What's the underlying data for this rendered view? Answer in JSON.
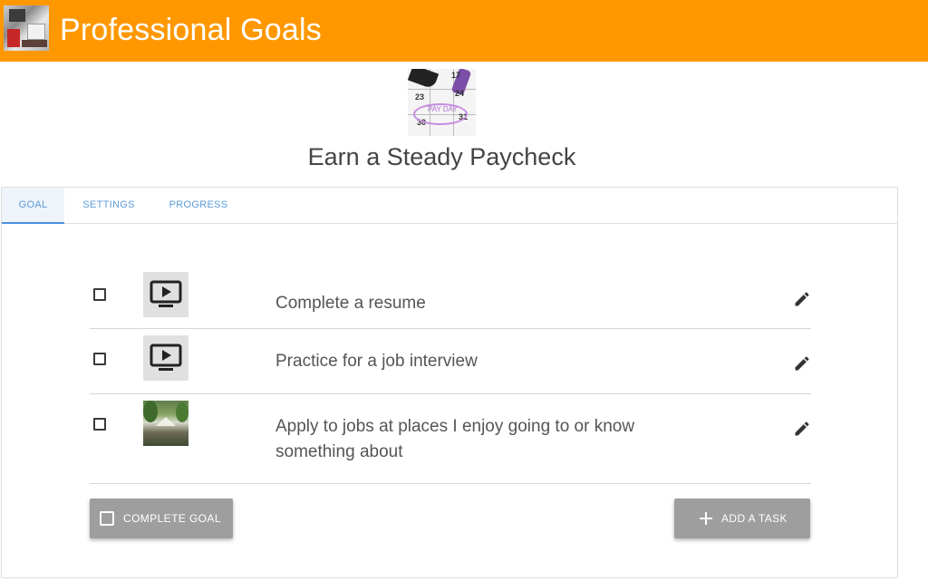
{
  "app": {
    "title": "Professional Goals",
    "logo_icon": "app-logo-photo",
    "bar_color": "#ff9800"
  },
  "goal": {
    "title": "Earn a Steady Paycheck",
    "image_icon": "calendar-payday-photo",
    "image_text": {
      "day1": "17",
      "day2": "23",
      "day3": "24",
      "day4": "30",
      "day5": "31",
      "circled": "PAY DAY"
    }
  },
  "tabs": [
    {
      "label": "GOAL",
      "active": true
    },
    {
      "label": "SETTINGS",
      "active": false
    },
    {
      "label": "PROGRESS",
      "active": false
    }
  ],
  "tasks": [
    {
      "text": "Complete a resume",
      "checked": false,
      "thumb_icon": "video-player-icon",
      "edit_icon": "pencil-icon"
    },
    {
      "text": "Practice for a job interview",
      "checked": false,
      "thumb_icon": "video-player-icon",
      "edit_icon": "pencil-icon"
    },
    {
      "text": "Apply to jobs at places I enjoy going to or know something about",
      "checked": false,
      "thumb_icon": "park-photo",
      "edit_icon": "pencil-icon"
    }
  ],
  "buttons": {
    "complete_goal": "COMPLETE GOAL",
    "add_task": "ADD A TASK"
  },
  "colors": {
    "accent_tab": "#4a90d9",
    "button_bg": "#9e9e9e"
  }
}
